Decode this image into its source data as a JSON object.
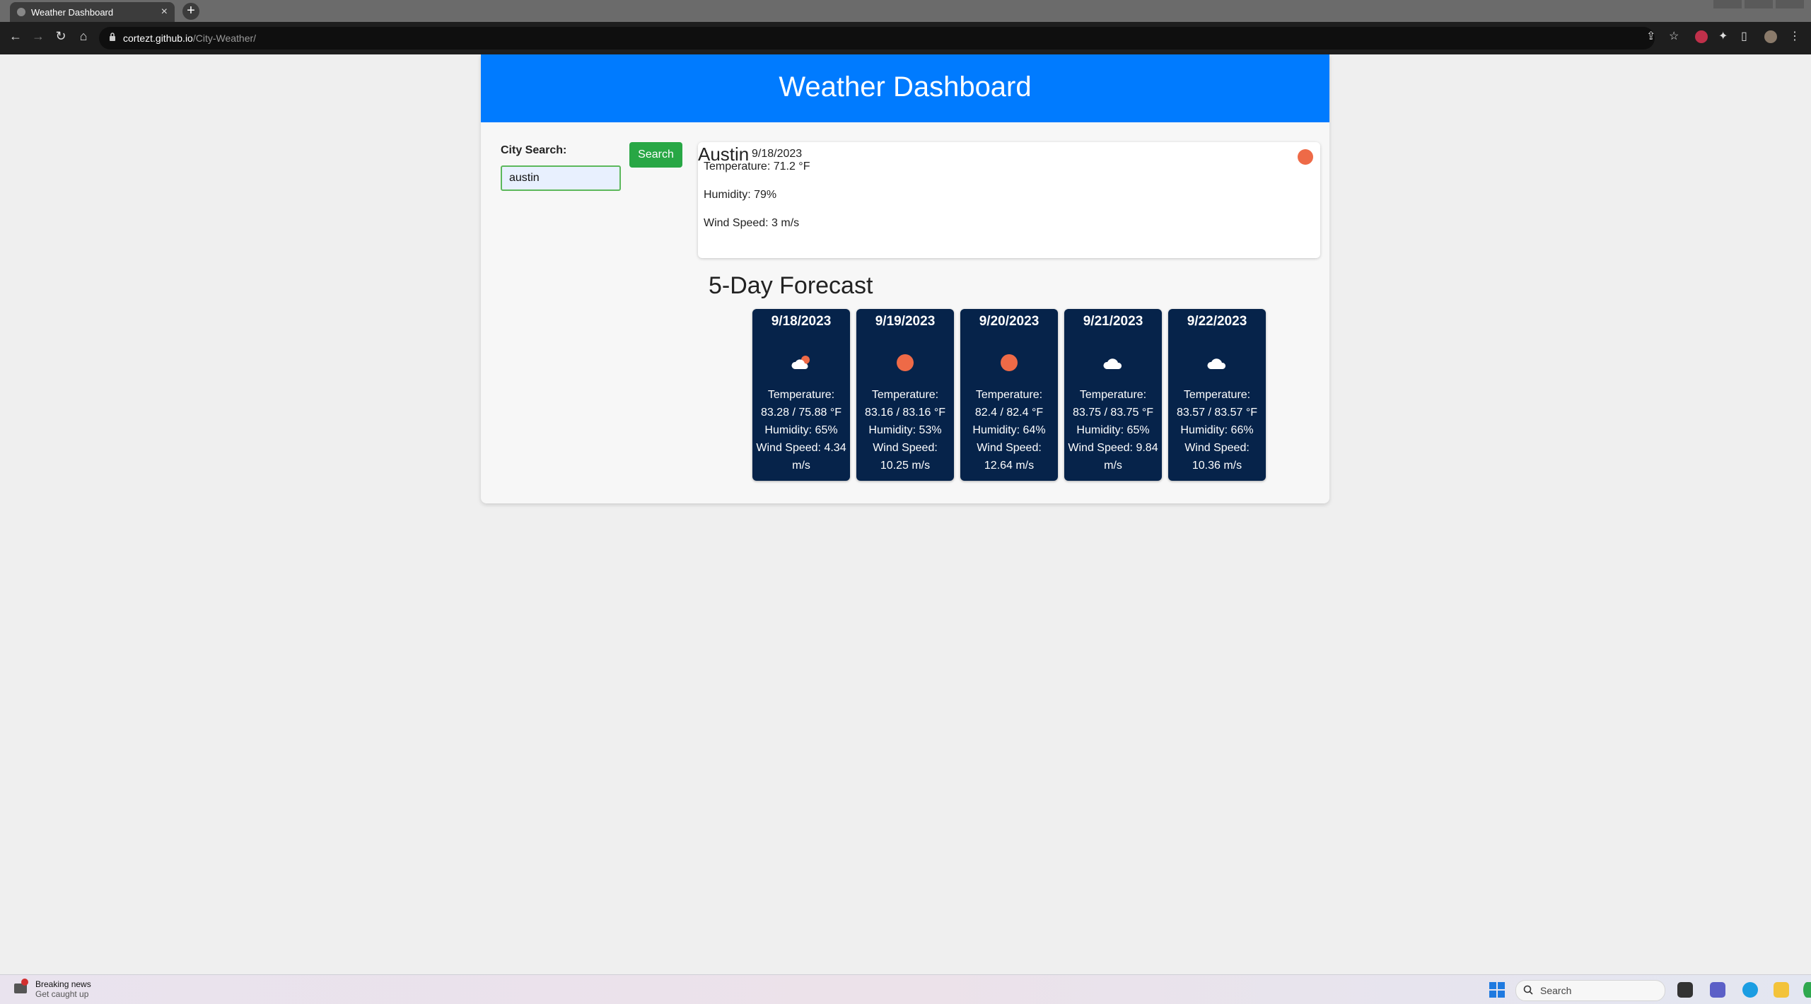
{
  "browser": {
    "tab_title": "Weather Dashboard",
    "tab_close": "×",
    "new_tab": "+",
    "url_host": "cortezt.github.io",
    "url_path": "/City-Weather/"
  },
  "header": {
    "title": "Weather Dashboard"
  },
  "search": {
    "label": "City Search:",
    "value": "austin",
    "button_label": "Search"
  },
  "current": {
    "city": "Austin",
    "date": "9/18/2023",
    "icon": "sun-icon",
    "temperature": "Temperature: 71.2 °F",
    "humidity": "Humidity: 79%",
    "wind": "Wind Speed: 3 m/s"
  },
  "forecast": {
    "title": "5-Day Forecast",
    "days": [
      {
        "date": "9/18/2023",
        "icon": "partly-cloudy-icon",
        "temp_label": "Temperature:",
        "temp": "83.28 / 75.88 °F",
        "humidity": "Humidity: 65%",
        "wind_a": "Wind Speed: 4.34",
        "wind_b": "m/s"
      },
      {
        "date": "9/19/2023",
        "icon": "sun-icon",
        "temp_label": "Temperature:",
        "temp": "83.16 / 83.16 °F",
        "humidity": "Humidity: 53%",
        "wind_a": "Wind Speed:",
        "wind_b": "10.25 m/s"
      },
      {
        "date": "9/20/2023",
        "icon": "sun-icon",
        "temp_label": "Temperature:",
        "temp": "82.4 / 82.4 °F",
        "humidity": "Humidity: 64%",
        "wind_a": "Wind Speed:",
        "wind_b": "12.64 m/s"
      },
      {
        "date": "9/21/2023",
        "icon": "cloud-icon",
        "temp_label": "Temperature:",
        "temp": "83.75 / 83.75 °F",
        "humidity": "Humidity: 65%",
        "wind_a": "Wind Speed: 9.84",
        "wind_b": "m/s"
      },
      {
        "date": "9/22/2023",
        "icon": "cloud-icon",
        "temp_label": "Temperature:",
        "temp": "83.57 / 83.57 °F",
        "humidity": "Humidity: 66%",
        "wind_a": "Wind Speed:",
        "wind_b": "10.36 m/s"
      }
    ]
  },
  "taskbar": {
    "news_title": "Breaking news",
    "news_sub": "Get caught up",
    "search_placeholder": "Search"
  },
  "colors": {
    "header": "#007bff",
    "search_button": "#28a745",
    "card_bg": "#06234a",
    "sun": "#ee6a47"
  }
}
